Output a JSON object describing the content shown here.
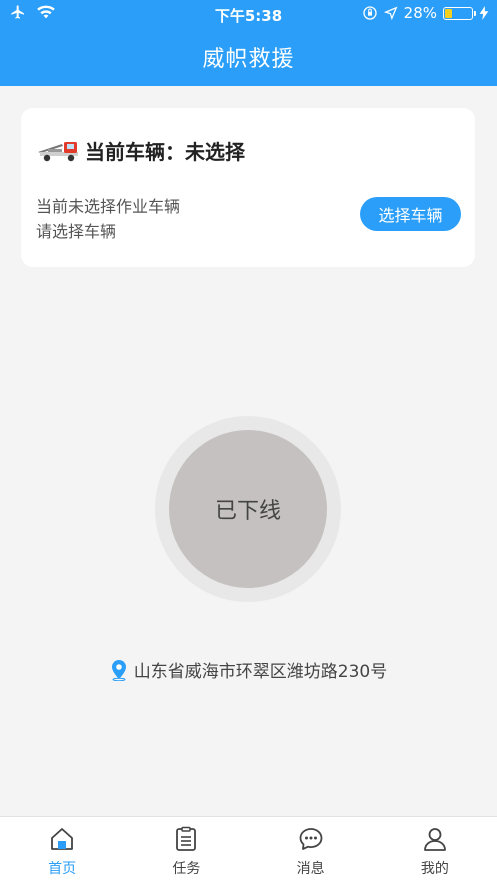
{
  "status_bar": {
    "time": "下午5:38",
    "battery_text": "28%",
    "battery_level": 0.28
  },
  "header": {
    "title": "威帜救援"
  },
  "vehicle_card": {
    "title": "当前车辆：未选择",
    "hint_line1": "当前未选择作业车辆",
    "hint_line2": "请选择车辆",
    "select_button": "选择车辆",
    "icon": "tow-truck-icon"
  },
  "status_circle": {
    "label": "已下线"
  },
  "location": {
    "address": "山东省威海市环翠区潍坊路230号",
    "icon": "location-pin-icon"
  },
  "tabbar": {
    "items": [
      {
        "label": "首页",
        "icon": "home-icon",
        "active": true
      },
      {
        "label": "任务",
        "icon": "task-list-icon",
        "active": false
      },
      {
        "label": "消息",
        "icon": "message-icon",
        "active": false
      },
      {
        "label": "我的",
        "icon": "user-icon",
        "active": false
      }
    ]
  },
  "colors": {
    "primary": "#2a9ef8",
    "offline_circle": "#c6c1c1",
    "background": "#f4f4f4"
  }
}
